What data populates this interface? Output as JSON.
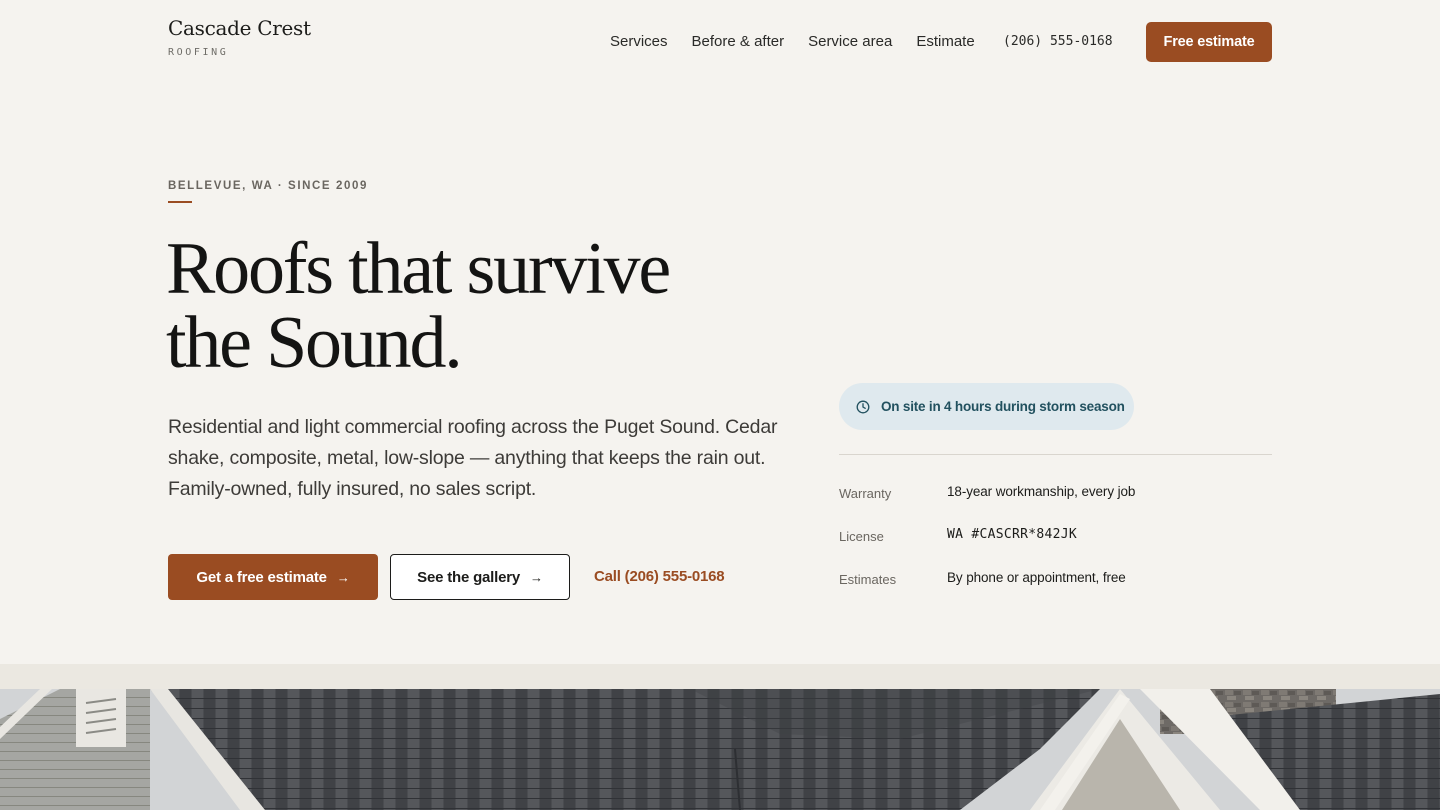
{
  "brand": {
    "name": "Cascade Crest",
    "sub": "ROOFING"
  },
  "nav": {
    "items": [
      {
        "label": "Services"
      },
      {
        "label": "Before & after"
      },
      {
        "label": "Service area"
      },
      {
        "label": "Estimate"
      }
    ],
    "phone": "(206) 555-0168",
    "cta": "Free estimate"
  },
  "hero": {
    "eyebrow": "BELLEVUE, WA · SINCE 2009",
    "headline_line1": "Roofs that survive",
    "headline_line2": "the Sound.",
    "lead": "Residential and light commercial roofing across the Puget Sound. Cedar shake, composite, metal, low-slope — anything that keeps the rain out. Family-owned, fully insured, no sales script.",
    "primary_cta": "Get a free estimate",
    "secondary_cta": "See the gallery",
    "arrow": "→",
    "call_link": "Call (206) 555-0168"
  },
  "info": {
    "pill": "On site in 4 hours during storm season",
    "pill_icon": "clock-icon",
    "facts": [
      {
        "label": "Warranty",
        "value": "18-year workmanship, every job"
      },
      {
        "label": "License",
        "value": "WA #CASCRR*842JK"
      },
      {
        "label": "Estimates",
        "value": "By phone or appointment, free"
      }
    ]
  },
  "colors": {
    "accent": "#9a4c22",
    "background": "#f5f3ef",
    "pill_bg": "#dfe9ee",
    "pill_text": "#22515f"
  }
}
